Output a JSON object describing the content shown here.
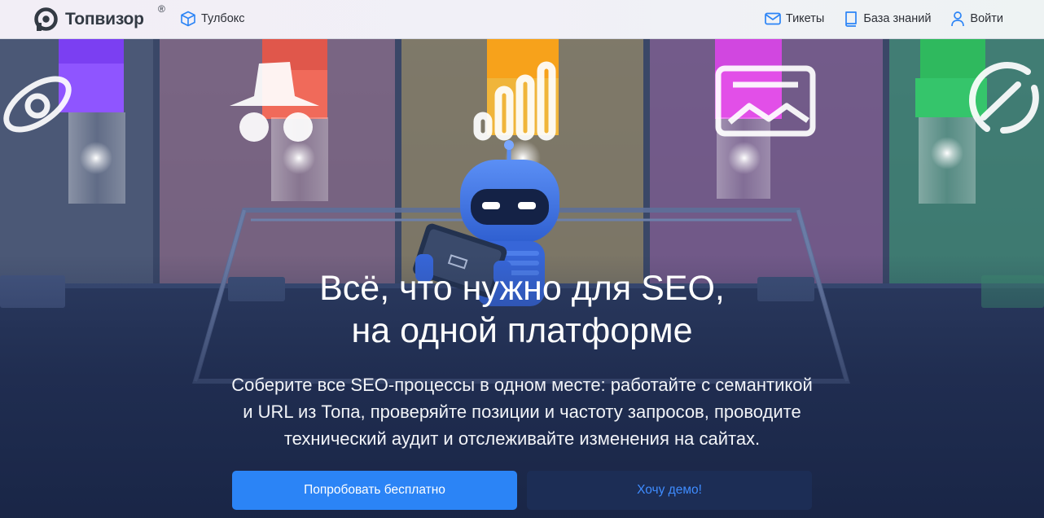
{
  "header": {
    "brand": "Топвизор",
    "brand_mark": "®",
    "toolbox_label": "Тулбокс",
    "nav": {
      "tickets": "Тикеты",
      "knowledge_base": "База знаний",
      "login": "Войти"
    },
    "icons": {
      "logo": "topvisor-logo-icon",
      "toolbox": "cube-icon",
      "tickets": "envelope-icon",
      "knowledge_base": "book-icon",
      "login": "user-icon"
    }
  },
  "hero": {
    "title_line1": "Всё, что нужно для SEO,",
    "title_line2": "на одной платформе",
    "subtitle_line1": "Соберите все SEO-процессы в одном месте: работайте с семантикой",
    "subtitle_line2": "и URL из Топа, проверяйте позиции и частоту запросов, проводите",
    "subtitle_line3": "технический аудит и отслеживайте изменения на сайтах.",
    "primary_button": "Попробовать бесплатно",
    "secondary_button": "Хочу демо!"
  },
  "colors": {
    "accent": "#2b84f6",
    "link": "#3f8cff",
    "secondary_bg": "#1c2d55",
    "tube_purple": "#7b3ff2",
    "tube_red": "#f06a5a",
    "tube_orange": "#f7a21b",
    "tube_pink": "#e24fe8",
    "tube_green": "#35c56b"
  }
}
